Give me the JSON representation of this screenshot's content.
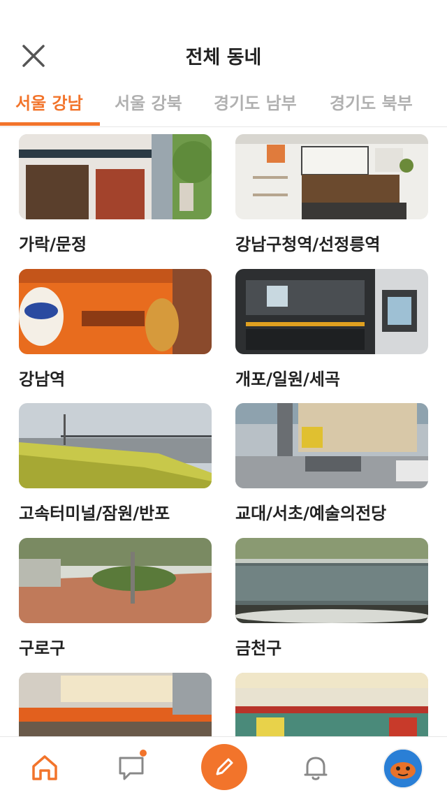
{
  "header": {
    "title": "전체 동네",
    "close_icon": "close-icon"
  },
  "tabs": [
    {
      "label": "서울 강남",
      "active": true
    },
    {
      "label": "서울 강북",
      "active": false
    },
    {
      "label": "경기도 남부",
      "active": false
    },
    {
      "label": "경기도 북부",
      "active": false
    }
  ],
  "neighborhoods": [
    {
      "label": "가락/문정"
    },
    {
      "label": "강남구청역/선정릉역"
    },
    {
      "label": "강남역"
    },
    {
      "label": "개포/일원/세곡"
    },
    {
      "label": "고속터미널/잠원/반포"
    },
    {
      "label": "교대/서초/예술의전당"
    },
    {
      "label": "구로구"
    },
    {
      "label": "금천구"
    },
    {
      "label": ""
    },
    {
      "label": ""
    }
  ],
  "bottom_nav": {
    "items": [
      "home-icon",
      "chat-icon",
      "write-icon",
      "bell-icon",
      "avatar"
    ],
    "chat_has_notification": true
  },
  "colors": {
    "accent": "#f2742b",
    "inactive_tab": "#b0b0b0",
    "text": "#222222"
  }
}
